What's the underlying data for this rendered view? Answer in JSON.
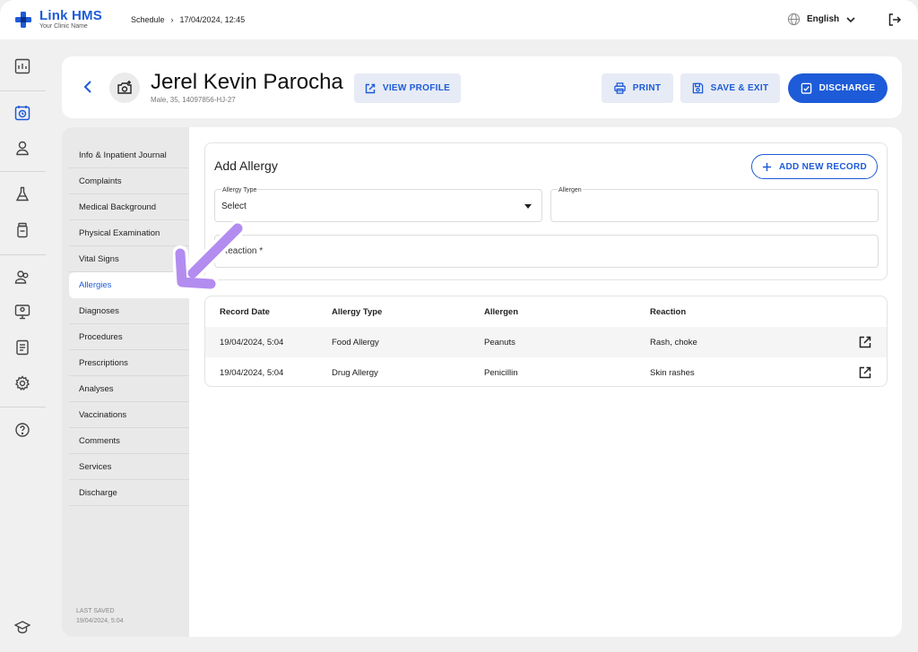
{
  "app": {
    "name": "Link HMS",
    "clinic": "Your Clinic Name"
  },
  "breadcrumb": {
    "section": "Schedule",
    "sep": "›",
    "datetime": "17/04/2024, 12:45"
  },
  "language": {
    "label": "English"
  },
  "patient": {
    "name": "Jerel Kevin Parocha",
    "meta": "Male, 35, 14097856-HJ-27"
  },
  "actions": {
    "view_profile": "VIEW PROFILE",
    "print": "PRINT",
    "save_exit": "SAVE & EXIT",
    "discharge": "DISCHARGE"
  },
  "nav": {
    "items": [
      "Info & Inpatient Journal",
      "Complaints",
      "Medical Background",
      "Physical Examination",
      "Vital Signs",
      "Allergies",
      "Diagnoses",
      "Procedures",
      "Prescriptions",
      "Analyses",
      "Vaccinations",
      "Comments",
      "Services",
      "Discharge"
    ],
    "active": "Allergies"
  },
  "last_saved": {
    "label": "LAST SAVED",
    "value": "19/04/2024, 5:04"
  },
  "form": {
    "title": "Add Allergy",
    "add_button": "ADD NEW RECORD",
    "allergy_type": {
      "label": "Allergy Type",
      "value": "Select"
    },
    "allergen": {
      "label": "Allergen",
      "value": ""
    },
    "reaction": {
      "placeholder": "Reaction *"
    }
  },
  "table": {
    "headers": [
      "Record Date",
      "Allergy Type",
      "Allergen",
      "Reaction"
    ],
    "rows": [
      [
        "19/04/2024, 5:04",
        "Food Allergy",
        "Peanuts",
        "Rash, choke"
      ],
      [
        "19/04/2024, 5:04",
        "Drug Allergy",
        "Penicillin",
        "Skin rashes"
      ]
    ]
  },
  "colors": {
    "accent": "#1d5bd8",
    "annotation": "#b38cf0"
  }
}
